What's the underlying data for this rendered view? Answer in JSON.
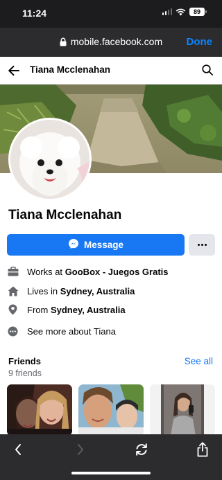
{
  "status_bar": {
    "time": "11:24",
    "battery": "89"
  },
  "browser": {
    "url": "mobile.facebook.com",
    "done_label": "Done"
  },
  "header": {
    "title": "Tiana Mcclenahan",
    "icons": [
      "back-arrow-icon",
      "search-icon"
    ]
  },
  "profile": {
    "name": "Tiana Mcclenahan",
    "message_label": "Message",
    "more_label": "…"
  },
  "intro": {
    "work_prefix": "Works at",
    "work_value": "GooBox - Juegos Gratis",
    "lives_prefix": "Lives in",
    "lives_value": "Sydney, Australia",
    "from_prefix": "From",
    "from_value": "Sydney, Australia",
    "see_more": "See more about Tiana"
  },
  "friends": {
    "title": "Friends",
    "count": "9 friends",
    "see_all": "See all"
  },
  "toolbar": {
    "icons": [
      "chevron-left-icon",
      "chevron-right-icon",
      "refresh-icon",
      "share-icon"
    ]
  },
  "colors": {
    "facebook_blue": "#1877f2",
    "ios_link_blue": "#0a84ff",
    "chrome_dark": "#2c2c2e",
    "secondary_text": "#65676b"
  }
}
